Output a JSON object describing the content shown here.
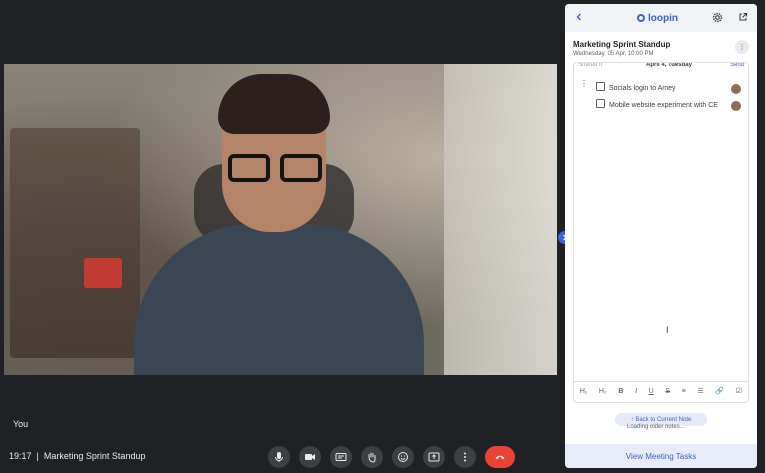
{
  "participant": {
    "label": "You"
  },
  "meeting": {
    "time": "19:17",
    "separator": "|",
    "title": "Marketing Sprint Standup"
  },
  "controls": [
    {
      "icon": "mic-icon"
    },
    {
      "icon": "camera-icon"
    },
    {
      "icon": "captions-icon"
    },
    {
      "icon": "raise-hand-icon"
    },
    {
      "icon": "emoji-icon"
    },
    {
      "icon": "present-icon"
    },
    {
      "icon": "more-vert-icon"
    },
    {
      "icon": "end-call-icon"
    }
  ],
  "panel": {
    "brand": "loopin",
    "meeting_title": "Marketing Sprint Standup",
    "meeting_datetime": "Wednesday, 05 Apr, 10:00 PM",
    "shared_text": "Shared n",
    "date_chip": "April 4, Tuesday",
    "send_label": "Send",
    "tasks": [
      {
        "text": "Socials login to Amey"
      },
      {
        "text": "Mobile website experiment with CE"
      }
    ],
    "toolbar": [
      "H₁",
      "H₂",
      "B",
      "I",
      "U",
      "S",
      "≡",
      "☰",
      "🔗",
      "☑"
    ],
    "back_to_note": "Back to Current Note",
    "older_notes": "Loading older notes...",
    "view_tasks": "View Meeting Tasks"
  },
  "colors": {
    "accent": "#3b63d8",
    "end_call": "#ea4335",
    "background": "#202124"
  }
}
